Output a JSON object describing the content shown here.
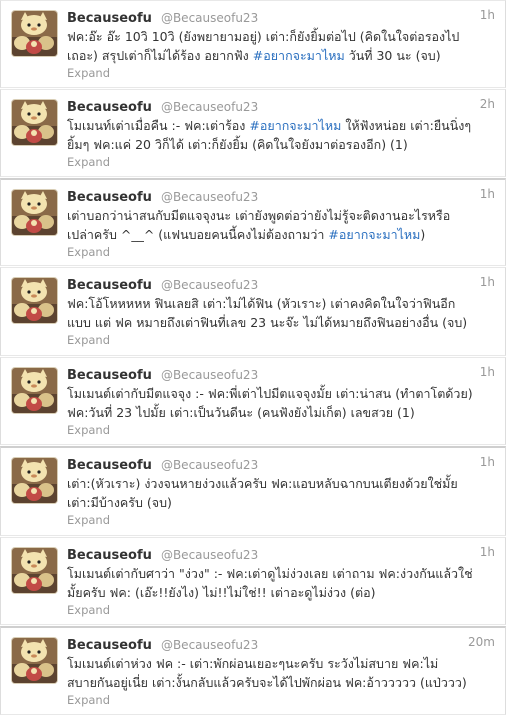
{
  "account": {
    "fullname": "Becauseofu",
    "username": "@Becauseofu23"
  },
  "expand_label": "Expand",
  "tweets": [
    {
      "time": "1h",
      "lines": [
        [
          "ฟค:อ๊ะ อ๊ะ 10วิ 10วิ (ยังพยายามอยู่) เต่า:ก็ยังยิ้มต่อไป (คิดในใจต่อรองไป"
        ],
        [
          "เถอะ) สรุปเต่าก็ไม่ได้ร้อง อยากฟัง ",
          "#อยากจะมาไหม",
          " วันที่ 30 นะ (จบ)"
        ]
      ]
    },
    {
      "time": "2h",
      "lines": [
        [
          "โมเมนท์เต่าเมื่อคืน :- ฟค:เต่าร้อง ",
          "#อยากจะมาไหม",
          " ให้ฟังหน่อย เต่า:ยืนนิ่งๆ"
        ],
        [
          "ยิ้มๆ ฟค:แค่ 20 วิก็ได้ เต่า:ก็ยังยิ้ม (คิดในใจยังมาต่อรองอีก) (1)"
        ]
      ]
    },
    {
      "time": "1h",
      "lines": [
        [
          "เต่าบอกว่าน่าสนกับมีตแจจุงนะ เต่ายังพูดต่อว่ายังไม่รู้จะติดงานอะไรหรือ"
        ],
        [
          "เปล่าครับ ^__^ (แฟนบอยคนนี้คงไม่ต้องถามว่า ",
          "#อยากจะมาไหม",
          ")"
        ]
      ]
    },
    {
      "time": "1h",
      "lines": [
        [
          "ฟค:โอ้โหหหหห ฟินเลยสิ เต่า:ไม่ได้ฟิน (หัวเราะ) เต่าคงคิดในใจว่าฟินอีก"
        ],
        [
          "แบบ แต่ ฟค หมายถึงเต่าฟินที่เลข 23 นะจ๊ะ ไม่ได้หมายถึงฟินอย่างอื่น (จบ)"
        ]
      ]
    },
    {
      "time": "1h",
      "lines": [
        [
          "โมเมนต์เต่ากับมีตแจจุง :- ฟค:พี่เต่าไปมีตแจจุงมั้ย เต่า:น่าสน (ทำตาโตด้วย)"
        ],
        [
          "ฟค:วันที่ 23 ไปมั้ย เต่า:เป็นวันดีนะ (คนฟังยังไม่เก็ต) เลขสวย (1)"
        ]
      ]
    },
    {
      "time": "1h",
      "lines": [
        [
          "เต่า:(หัวเราะ) ง่วงจนหายง่วงแล้วครับ ฟค:แอบหลับฉากบนเตียงด้วยใช่มั้ย"
        ],
        [
          "เต่า:มีบ้างครับ (จบ)"
        ]
      ]
    },
    {
      "time": "1h",
      "lines": [
        [
          "โมเมนต์เต่ากับศาว่า \"ง่วง\" :- ฟค:เต่าดูไม่ง่วงเลย เต่าถาม ฟค:ง่วงกันแล้วใช่"
        ],
        [
          "มั้ยครับ ฟค: (เอ๊ะ!!ยังไง) ไม่!!ไม่ใช่!! เต่าอะดูไม่ง่วง (ต่อ)"
        ]
      ]
    },
    {
      "time": "20m",
      "lines": [
        [
          "โมเมนต์เต่าห่วง ฟค :- เต่า:พักผ่อนเยอะๆนะครับ ระวังไม่สบาย ฟค:ไม่"
        ],
        [
          "สบายกันอยู่เนี่ย เต่า:งั้นกลับแล้วครับจะได้ไปพักผ่อน ฟค:อ้าววววว (แป่ววว)"
        ]
      ]
    }
  ]
}
